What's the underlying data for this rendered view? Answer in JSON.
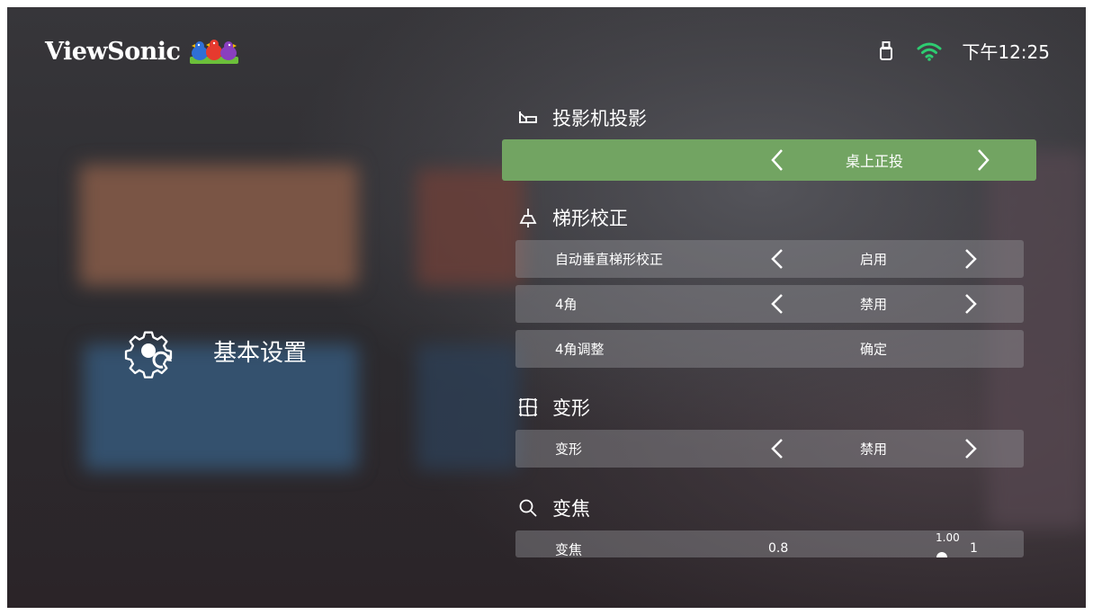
{
  "brand": {
    "name": "ViewSonic",
    "logo_icon": "three-birds-logo-icon"
  },
  "status_bar": {
    "usb_icon": "usb-drive-icon",
    "wifi_icon": "wifi-icon",
    "wifi_color": "#2ecc71",
    "time": "下午12:25"
  },
  "side_panel": {
    "icon": "gear-icon",
    "title": "基本设置"
  },
  "sections": {
    "projection": {
      "icon": "projector-icon",
      "title": "投影机投影",
      "row": {
        "value": "桌上正投"
      }
    },
    "keystone": {
      "icon": "keystone-icon",
      "title": "梯形校正",
      "rows": [
        {
          "label": "自动垂直梯形校正",
          "value": "启用"
        },
        {
          "label": "4角",
          "value": "禁用"
        },
        {
          "label": "4角调整",
          "value": "确定"
        }
      ]
    },
    "warp": {
      "icon": "warp-grid-icon",
      "title": "变形",
      "row": {
        "label": "变形",
        "value": "禁用"
      }
    },
    "zoom": {
      "icon": "magnifier-icon",
      "title": "变焦",
      "row": {
        "label": "变焦",
        "min": "0.8",
        "current": "1.00",
        "max": "1"
      }
    }
  },
  "colors": {
    "selected_row": "#72a462",
    "row_bg": "rgba(150,150,155,0.42)"
  }
}
